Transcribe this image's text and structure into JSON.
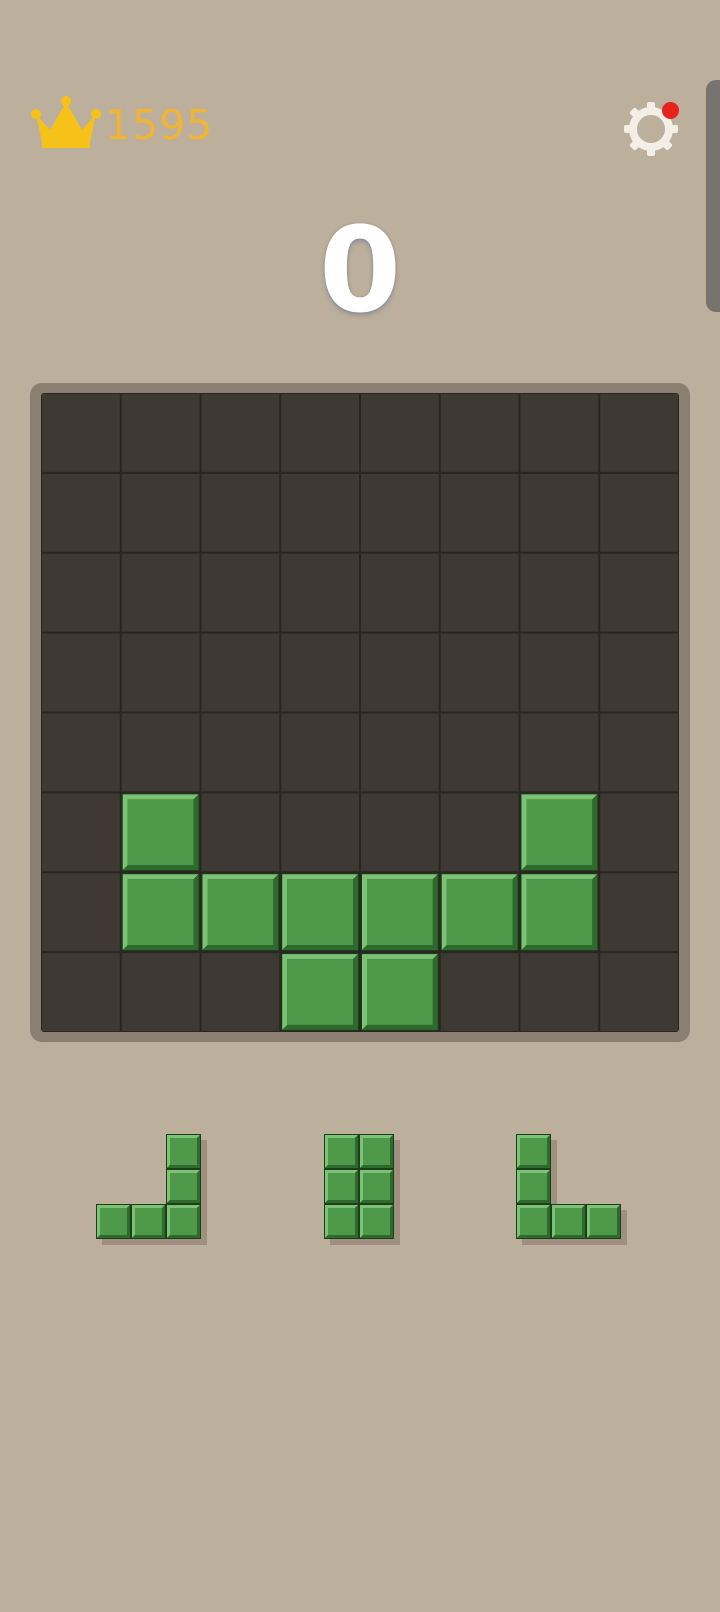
{
  "header": {
    "best_score": "1595",
    "crown_icon": "crown-icon",
    "settings_icon": "gear-icon",
    "has_notification": true
  },
  "score": "0",
  "colors": {
    "background": "#bcaf9b",
    "board_frame": "#8b7f72",
    "board_cell": "#3f3934",
    "board_grid_line": "#2a2522",
    "block_fill": "#4e9a4a",
    "block_light": "#7cc274",
    "block_dark": "#2e6a2b",
    "block_outline": "#1f3d1d",
    "best_score_text": "#f0b436",
    "crown": "#f6c21a",
    "score_text": "#ffffff",
    "gear": "#f4efe6",
    "notification_dot": "#e8231c",
    "piece_shadow": "#9e8f7e"
  },
  "board": {
    "rows": 8,
    "cols": 8,
    "filled": [
      [
        5,
        1
      ],
      [
        5,
        6
      ],
      [
        6,
        1
      ],
      [
        6,
        2
      ],
      [
        6,
        3
      ],
      [
        6,
        4
      ],
      [
        6,
        5
      ],
      [
        6,
        6
      ],
      [
        7,
        3
      ],
      [
        7,
        4
      ]
    ]
  },
  "tray": {
    "pieces": [
      {
        "name": "j-piece",
        "cells": [
          [
            0,
            2
          ],
          [
            1,
            2
          ],
          [
            2,
            0
          ],
          [
            2,
            1
          ],
          [
            2,
            2
          ]
        ]
      },
      {
        "name": "square-2x3-piece",
        "cells": [
          [
            0,
            0
          ],
          [
            0,
            1
          ],
          [
            1,
            0
          ],
          [
            1,
            1
          ],
          [
            2,
            0
          ],
          [
            2,
            1
          ]
        ]
      },
      {
        "name": "l-piece",
        "cells": [
          [
            0,
            0
          ],
          [
            1,
            0
          ],
          [
            2,
            0
          ],
          [
            2,
            1
          ],
          [
            2,
            2
          ]
        ]
      }
    ]
  }
}
